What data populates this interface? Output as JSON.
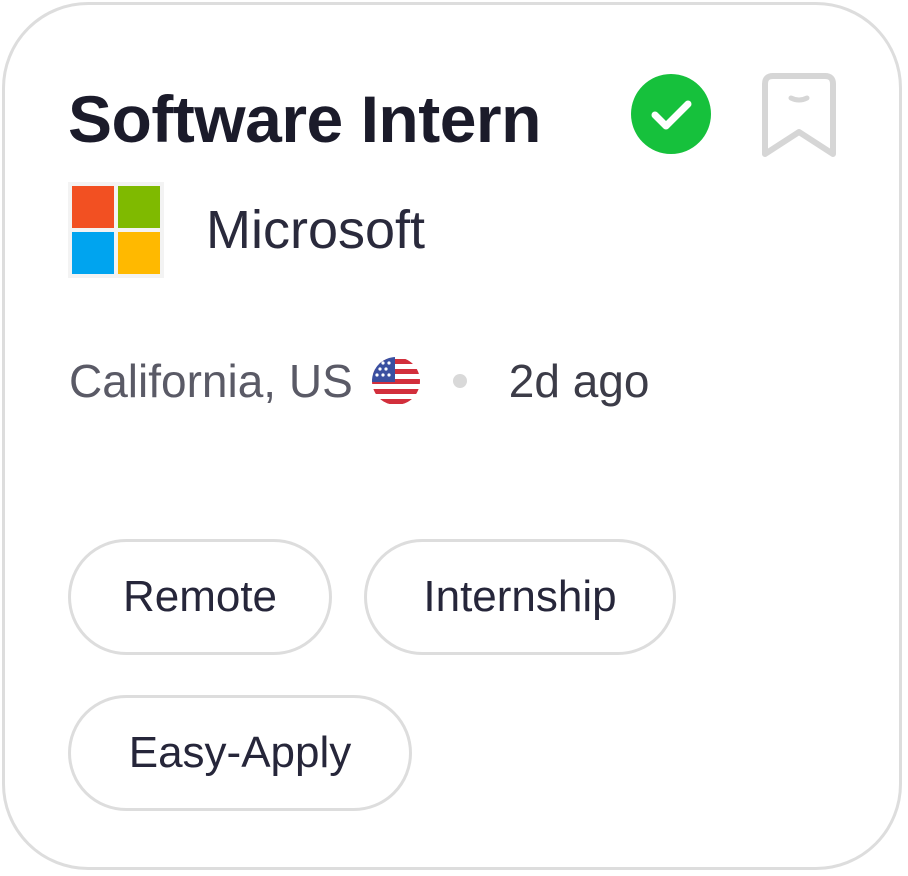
{
  "job": {
    "title": "Software Intern",
    "company": "Microsoft",
    "location": "California, US",
    "posted": "2d ago"
  },
  "tags": [
    "Remote",
    "Internship",
    "Easy-Apply"
  ],
  "icons": {
    "verified": "verified-check-icon",
    "bookmark": "bookmark-icon",
    "logo": "microsoft-logo",
    "flag": "us-flag-icon"
  },
  "colors": {
    "verified_green": "#16c13c",
    "border": "#dddddd",
    "title": "#1b1b2a",
    "ms_red": "#f25022",
    "ms_green": "#7fba00",
    "ms_blue": "#00a4ef",
    "ms_yellow": "#ffb900"
  }
}
